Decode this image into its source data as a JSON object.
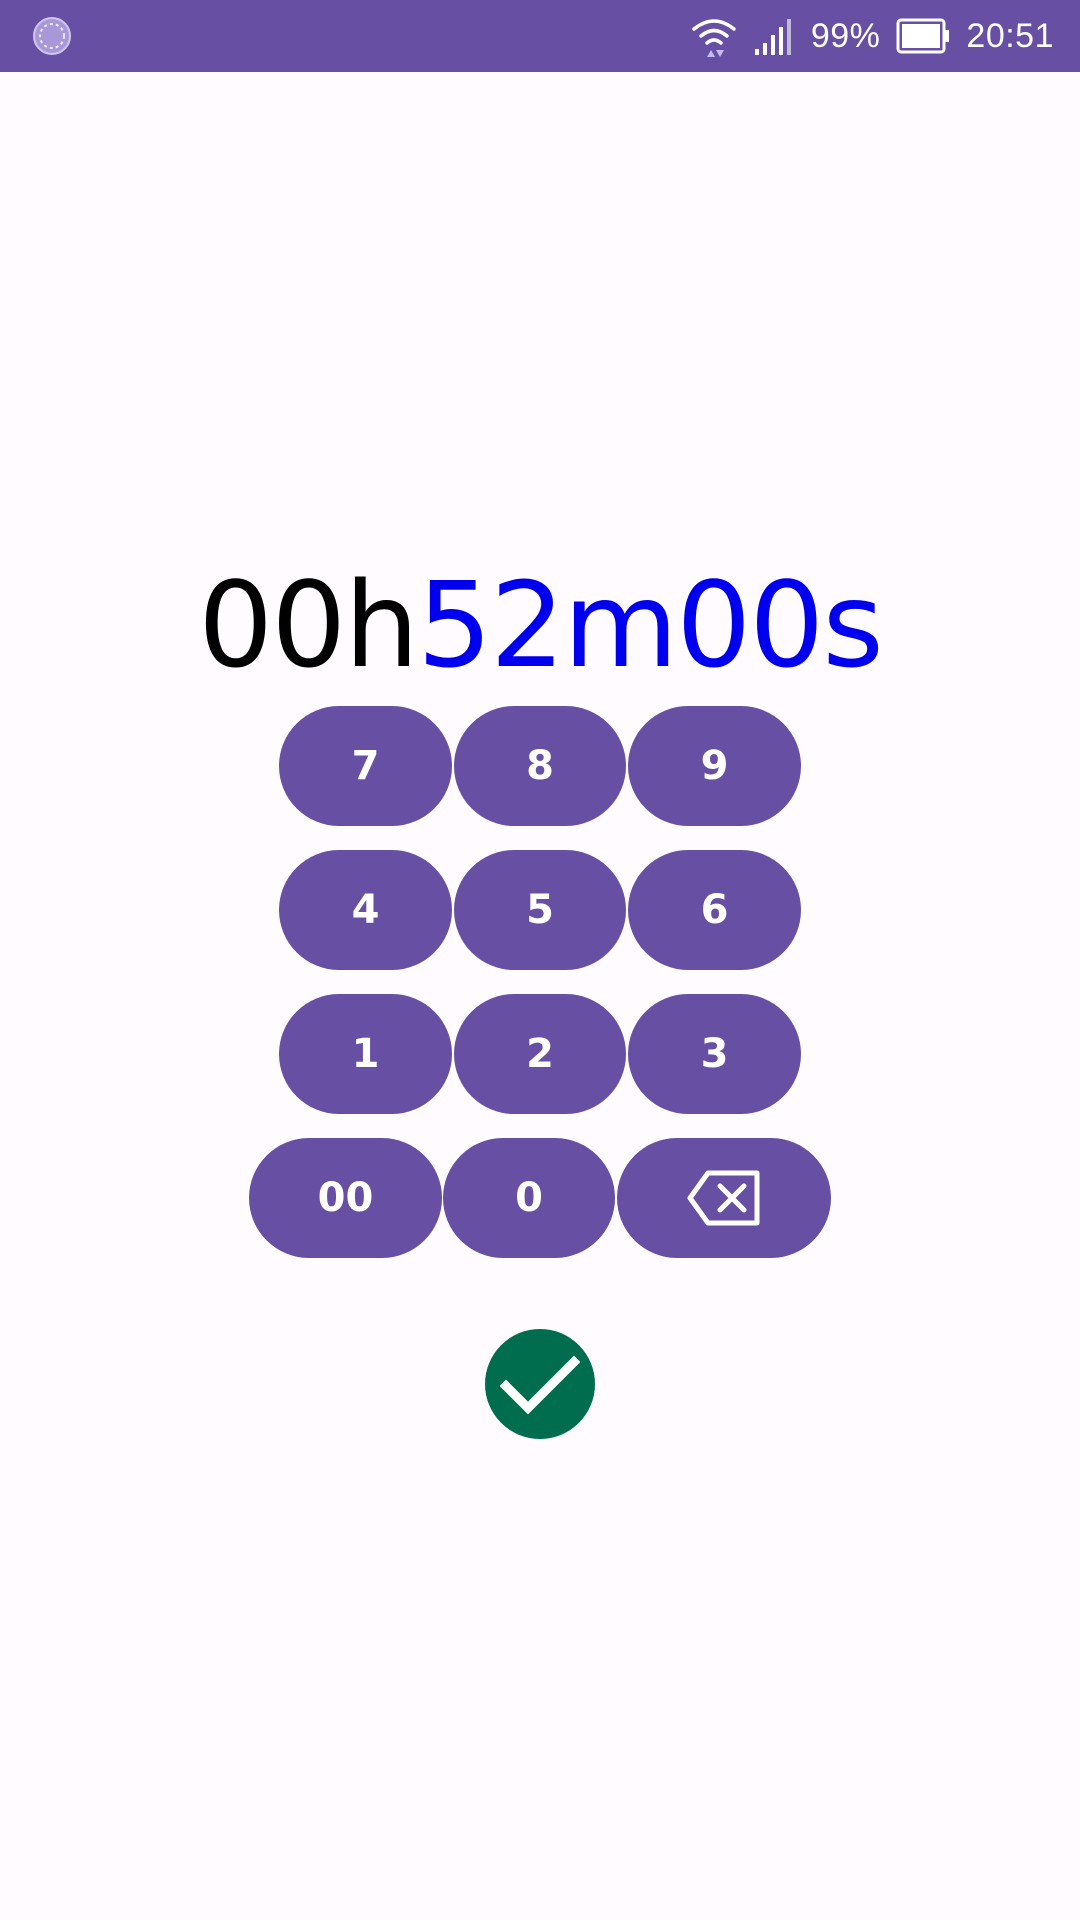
{
  "status_bar": {
    "battery_percent": "99%",
    "time": "20:51",
    "background_color": "#6750a4",
    "icons": [
      "app-notification-icon",
      "wifi-icon",
      "signal-icon",
      "battery-icon"
    ]
  },
  "timer": {
    "hours": "00h",
    "minutes_seconds": "52m00s",
    "hours_color": "#000000",
    "entered_color": "#0000ee"
  },
  "keypad": {
    "keys": [
      "7",
      "8",
      "9",
      "4",
      "5",
      "6",
      "1",
      "2",
      "3",
      "00",
      "0"
    ],
    "backspace_icon": "backspace-icon",
    "key_color": "#6750a4"
  },
  "confirm": {
    "icon": "check-icon",
    "color": "#006e4e"
  }
}
